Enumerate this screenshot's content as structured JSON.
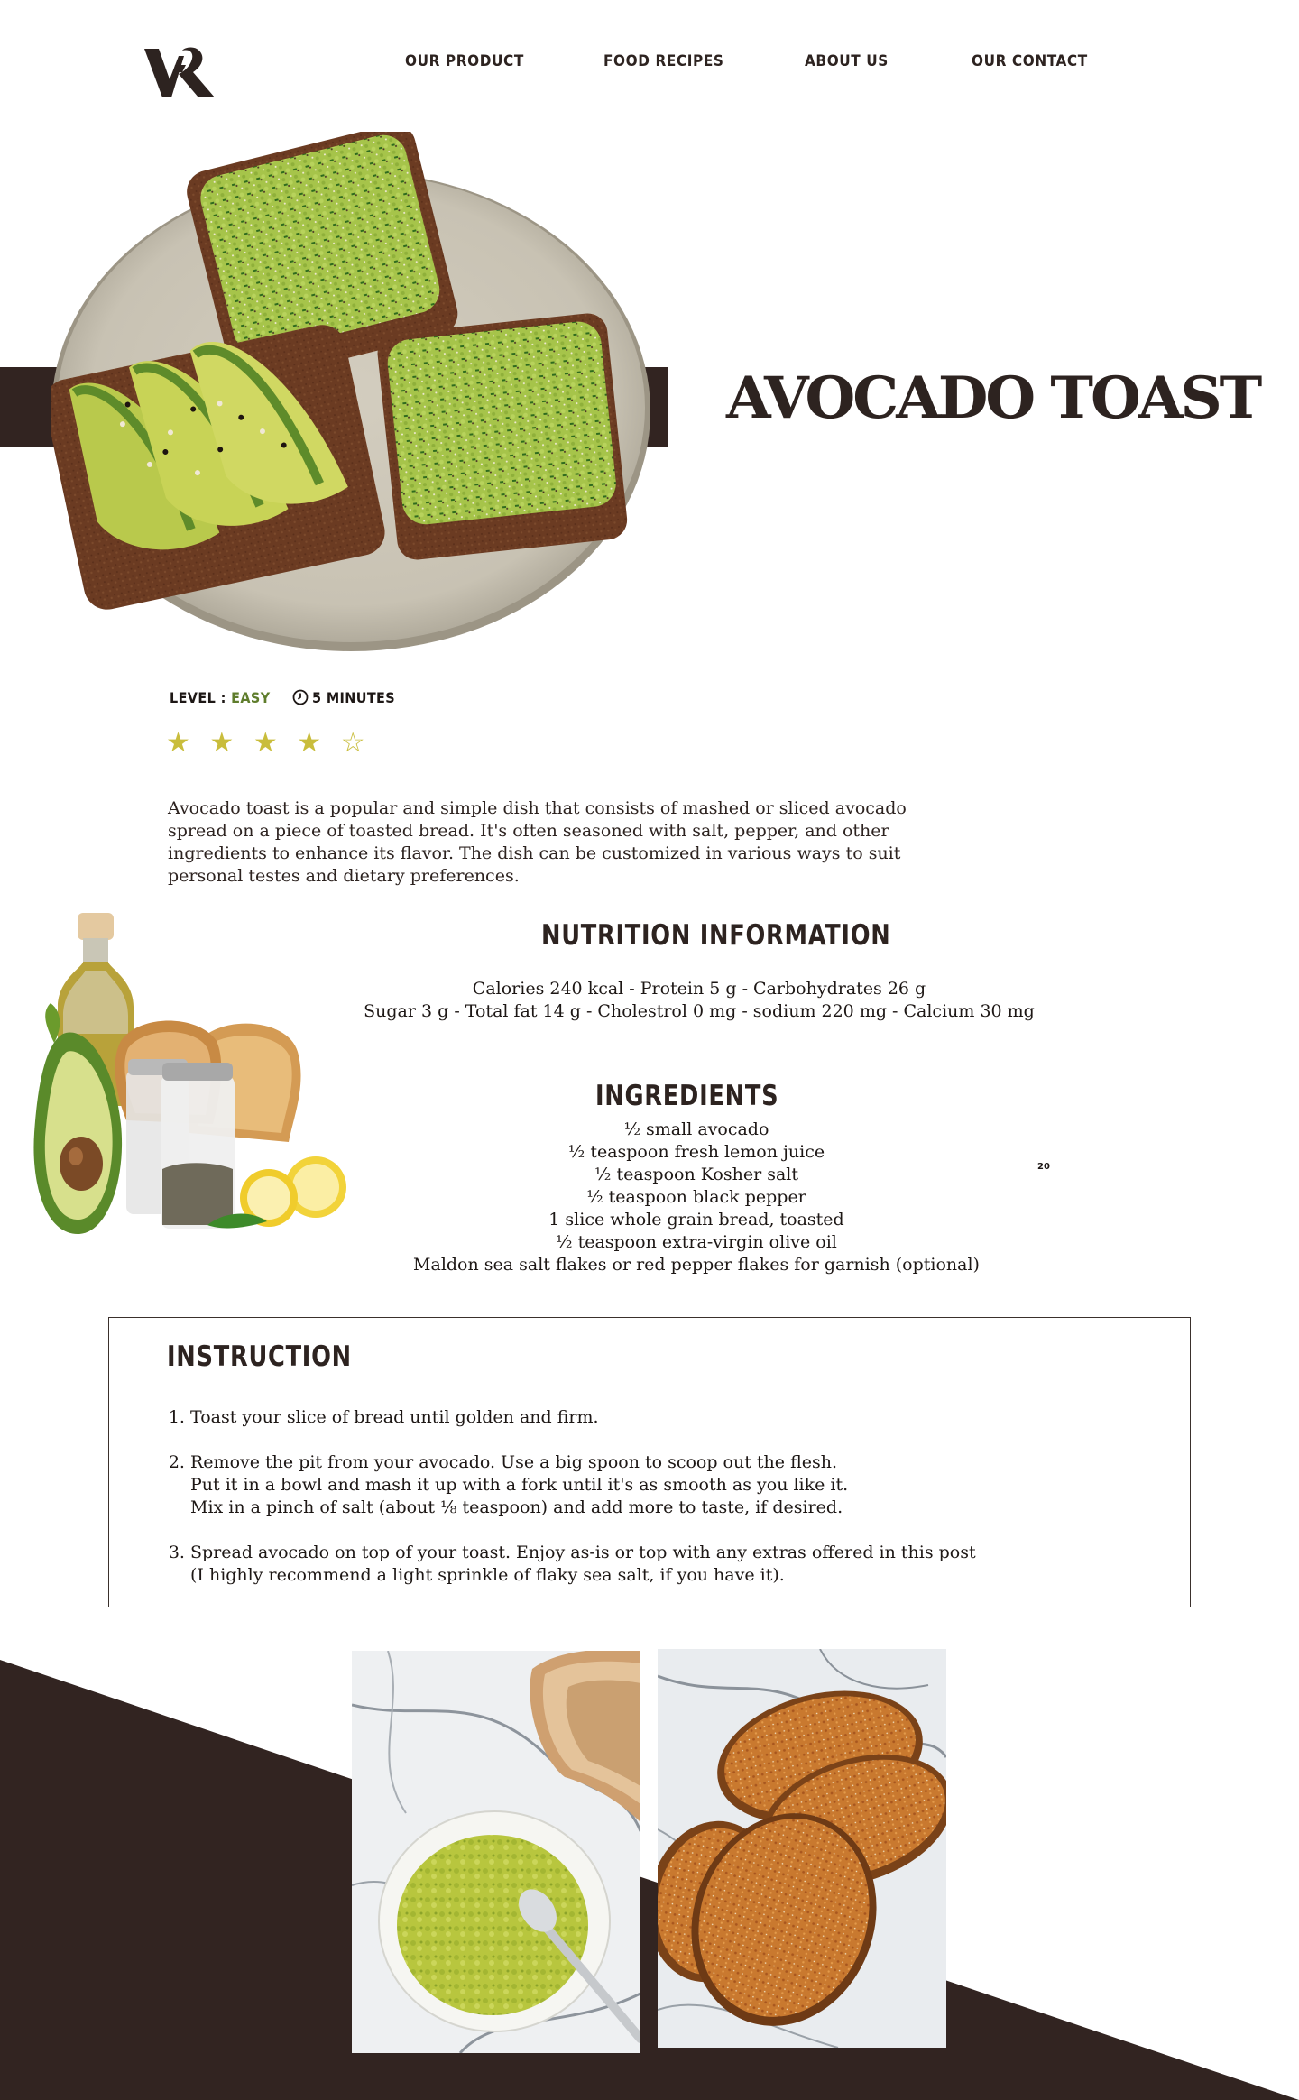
{
  "nav": {
    "logo_alt": "VK",
    "items": [
      {
        "label": "OUR PRODUCT"
      },
      {
        "label": "FOOD RECIPES"
      },
      {
        "label": "ABOUT US"
      },
      {
        "label": "OUR CONTACT"
      }
    ]
  },
  "hero": {
    "title": "AVOCADO TOAST"
  },
  "meta": {
    "level_label": "LEVEL :",
    "level_value": "EASY",
    "time": "5 MINUTES",
    "stars": "★ ★ ★ ★ ☆",
    "rating": 4,
    "rating_max": 5
  },
  "description": "Avocado toast is a popular and simple dish that consists of mashed or sliced avocado spread on a piece of toasted bread. It's often seasoned with salt, pepper, and other ingredients to enhance its flavor. The dish can be customized in various ways to suit personal testes and dietary preferences.",
  "nutrition": {
    "title": "NUTRITION INFORMATION",
    "line1": "Calories 240 kcal - Protein 5 g - Carbohydrates 26 g",
    "line2": "Sugar 3 g - Total fat 14 g - Cholestrol 0 mg - sodium 220 mg - Calcium 30 mg"
  },
  "ingredients": {
    "title": "INGREDIENTS",
    "items": [
      "½ small avocado",
      "½ teaspoon fresh lemon juice",
      "½ teaspoon Kosher salt",
      "½ teaspoon black pepper",
      "1 slice whole grain bread, toasted",
      "½ teaspoon extra-virgin olive oil",
      "Maldon sea salt flakes or red pepper flakes for garnish (optional)"
    ],
    "page_number": "20"
  },
  "instruction": {
    "title": "INSTRUCTION",
    "steps": [
      {
        "lines": [
          "Toast your slice of bread until golden and firm."
        ]
      },
      {
        "lines": [
          "Remove the pit from your avocado. Use a big spoon to scoop out the flesh.",
          "Put it in a bowl and mash it up with a fork until it's as smooth as you like it.",
          "Mix in a pinch of salt (about ⅛ teaspoon) and add more to taste, if desired."
        ]
      },
      {
        "lines": [
          "Spread avocado on top of your toast. Enjoy as-is or top with any extras offered in this post",
          "(I highly recommend a light sprinkle of flaky sea salt, if you have it)."
        ]
      }
    ]
  },
  "colors": {
    "brand_dark": "#322421",
    "accent_green": "#5f7d2c",
    "star_yellow": "#c9bd3c"
  }
}
